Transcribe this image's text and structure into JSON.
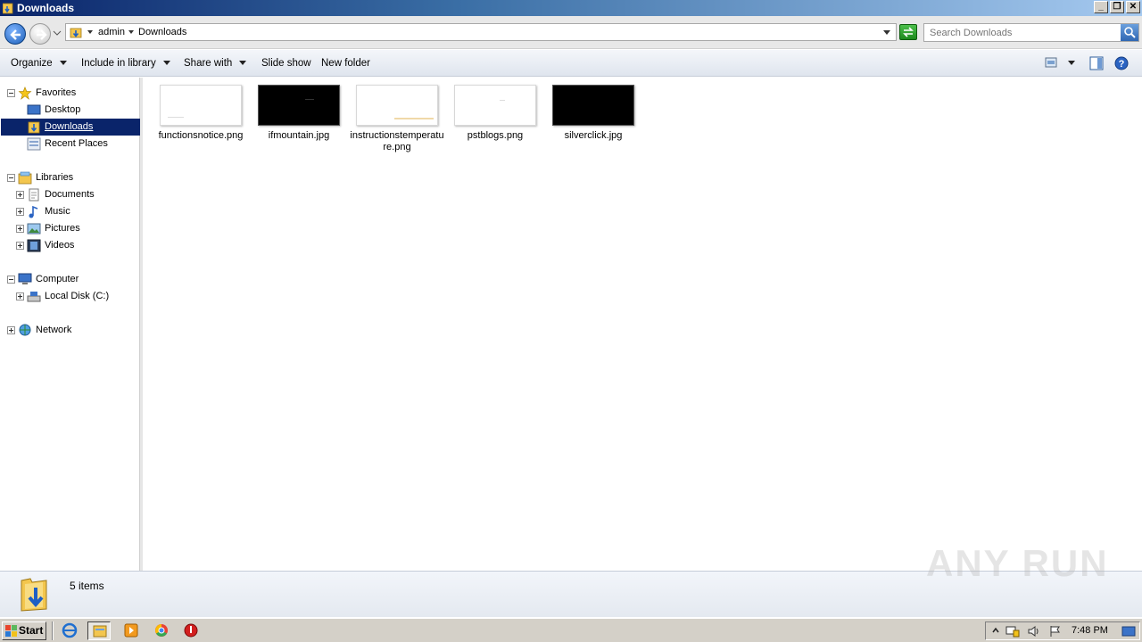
{
  "window": {
    "title": "Downloads"
  },
  "window_buttons": {
    "minimize": "_",
    "maximize": "❐",
    "close": "✕"
  },
  "address": {
    "crumbs": [
      "admin",
      "Downloads"
    ]
  },
  "search": {
    "placeholder": "Search Downloads"
  },
  "toolbar": {
    "organize": "Organize",
    "include_in_library": "Include in library",
    "share_with": "Share with",
    "slide_show": "Slide show",
    "new_folder": "New folder"
  },
  "nav": {
    "favorites": "Favorites",
    "desktop": "Desktop",
    "downloads": "Downloads",
    "recent_places": "Recent Places",
    "libraries": "Libraries",
    "documents": "Documents",
    "music": "Music",
    "pictures": "Pictures",
    "videos": "Videos",
    "computer": "Computer",
    "local_disk": "Local Disk (C:)",
    "network": "Network"
  },
  "files": [
    {
      "name": "functionsnotice.png",
      "thumb": "light"
    },
    {
      "name": "ifmountain.jpg",
      "thumb": "dark"
    },
    {
      "name": "instructionstemperature.png",
      "thumb": "light"
    },
    {
      "name": "pstblogs.png",
      "thumb": "light"
    },
    {
      "name": "silverclick.jpg",
      "thumb": "dark"
    }
  ],
  "details": {
    "count": "5 items"
  },
  "watermark": "ANY RUN",
  "taskbar": {
    "start": "Start",
    "clock": "7:48 PM"
  },
  "colors": {
    "selection": "#0a246a",
    "title_gradient_start": "#0a246a",
    "title_gradient_end": "#a6caf0"
  }
}
